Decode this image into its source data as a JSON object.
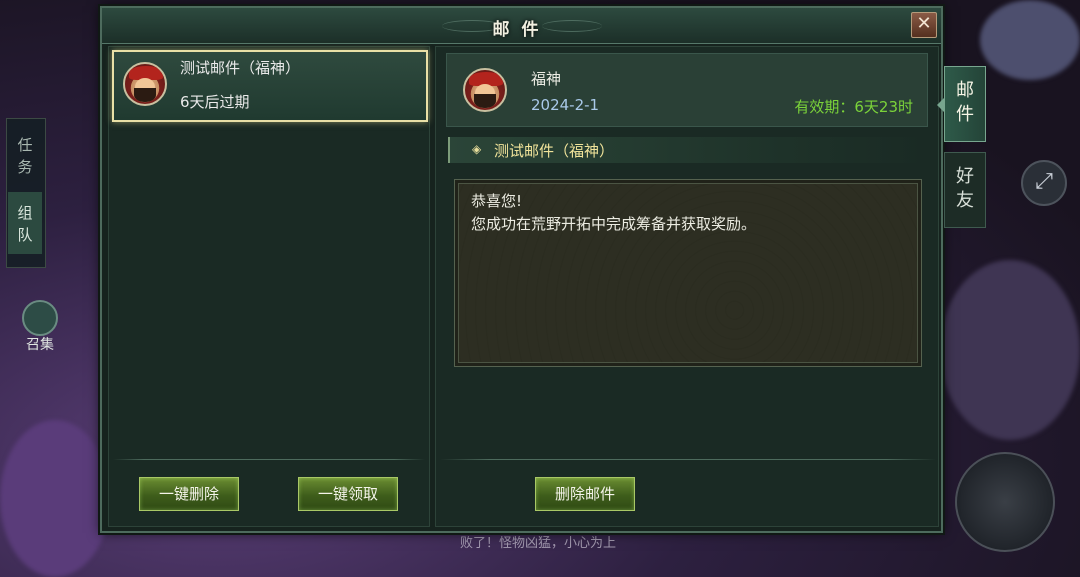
{
  "window": {
    "title": "邮件",
    "close_symbol": "✕"
  },
  "mail_list": {
    "items": [
      {
        "title": "测试邮件（福神）",
        "expiry": "6天后过期",
        "avatar": "fushen-avatar-icon"
      }
    ]
  },
  "list_actions": {
    "delete_all_label": "一键删除",
    "claim_all_label": "一键领取"
  },
  "detail": {
    "sender": "福神",
    "date": "2024-2-1",
    "validity": "有效期：6天23时",
    "subject": "测试邮件（福神）",
    "subject_icon": "◈",
    "content_lines": [
      "恭喜您!",
      "您成功在荒野开拓中完成筹备并获取奖励。"
    ],
    "delete_label": "删除邮件"
  },
  "side_tabs": [
    {
      "label_line1": "邮",
      "label_line2": "件",
      "active": true
    },
    {
      "label_line1": "好",
      "label_line2": "友",
      "active": false
    }
  ],
  "background": {
    "left_tabs": [
      {
        "line1": "任",
        "line2": "务"
      },
      {
        "line1": "组",
        "line2": "队"
      }
    ],
    "summon_label": "召集",
    "chat_text": "败了！怪物凶猛，小心为上"
  },
  "colors": {
    "accent_green": "#7bd33a",
    "date_blue": "#a9c9e9",
    "subject_gold": "#f0e39a"
  }
}
